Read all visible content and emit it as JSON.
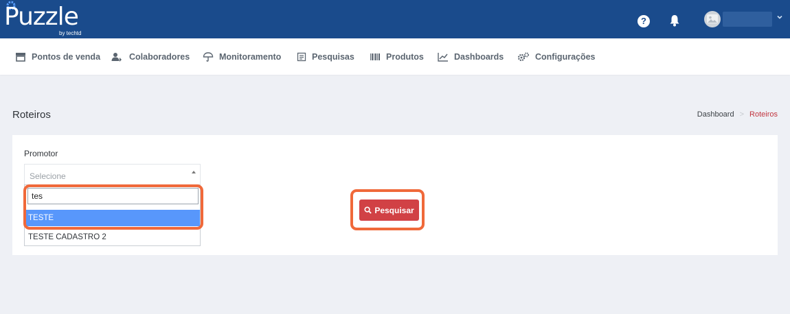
{
  "brand": {
    "name": "Puzzle",
    "sub": "by techtd"
  },
  "header": {
    "help_icon": "question-circle-icon",
    "bell_icon": "bell-icon",
    "user_chevron": "chevron-down-icon"
  },
  "nav": {
    "items": [
      {
        "label": "Pontos de venda",
        "icon": "store-icon"
      },
      {
        "label": "Colaboradores",
        "icon": "users-icon"
      },
      {
        "label": "Monitoramento",
        "icon": "umbrella-icon"
      },
      {
        "label": "Pesquisas",
        "icon": "survey-icon"
      },
      {
        "label": "Produtos",
        "icon": "barcode-icon"
      },
      {
        "label": "Dashboards",
        "icon": "chart-icon"
      },
      {
        "label": "Configurações",
        "icon": "gears-icon"
      }
    ]
  },
  "page": {
    "title": "Roteiros"
  },
  "breadcrumb": {
    "home": "Dashboard",
    "separator": ">",
    "current": "Roteiros"
  },
  "form": {
    "promotor_label": "Promotor",
    "select_placeholder": "Selecione",
    "search_value": "tes",
    "options": [
      "TESTE",
      "TESTE CADASTRO 2"
    ],
    "selected_option": "TESTE",
    "search_button": "Pesquisar"
  },
  "colors": {
    "topbar": "#1a4b8c",
    "accent_red": "#d14145",
    "highlight": "#f0693a",
    "option_active": "#5897fb",
    "breadcrumb_active": "#c1333d"
  }
}
